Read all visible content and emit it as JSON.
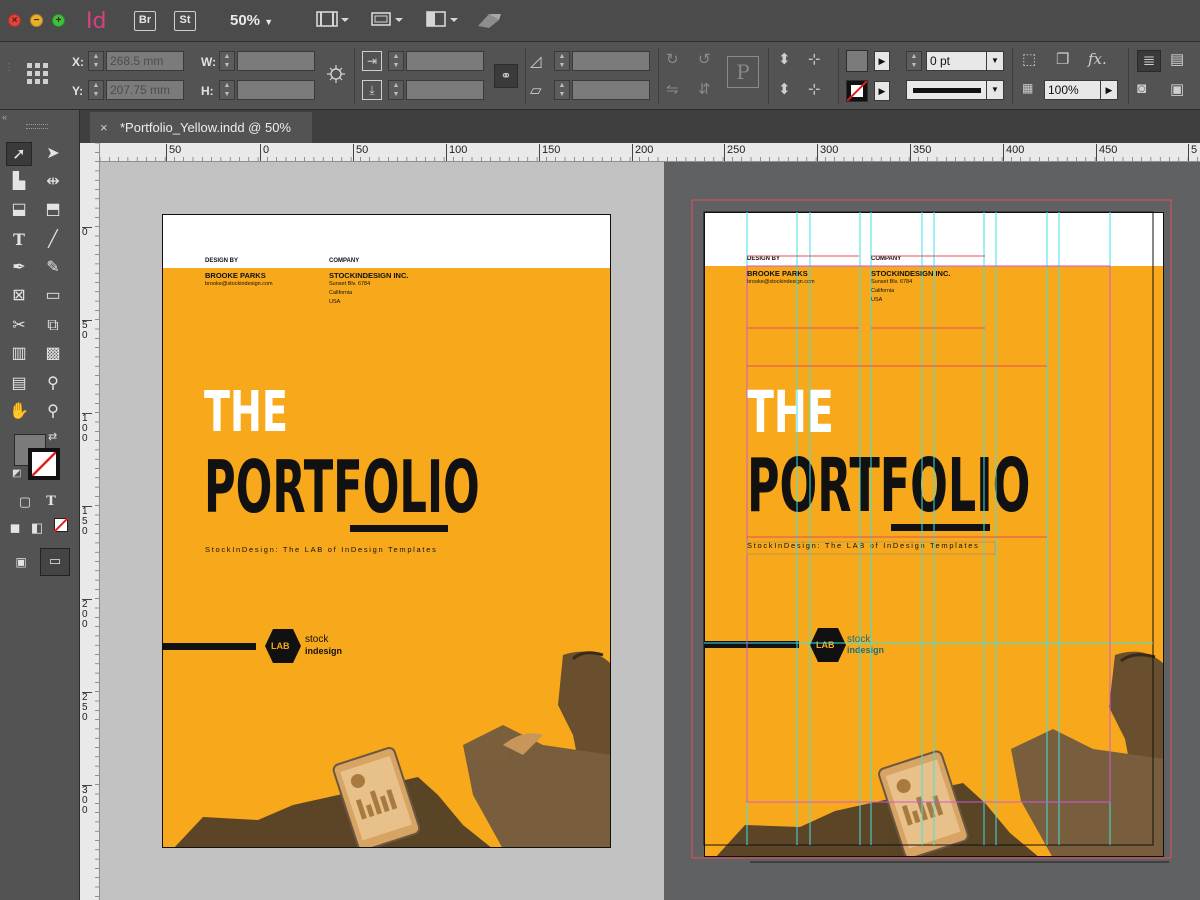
{
  "app": {
    "logo": "Id",
    "bridge_btn": "Br",
    "stock_btn": "St",
    "zoom": "50%",
    "zoom_caret": "▼"
  },
  "control": {
    "x_label": "X:",
    "y_label": "Y:",
    "w_label": "W:",
    "h_label": "H:",
    "x_value": "268.5 mm",
    "y_value": "207.75 mm",
    "stroke_weight": "0 pt",
    "scale": "100%",
    "fx_label": "fx."
  },
  "tab": {
    "close": "×",
    "title": "*Portfolio_Yellow.indd @ 50%"
  },
  "ruler": {
    "h_labels": [
      "50",
      "0",
      "50",
      "100",
      "150",
      "200",
      "250",
      "300",
      "350",
      "400",
      "450",
      "5"
    ],
    "v_labels": [
      "0",
      "50",
      "100",
      "150",
      "200",
      "250",
      "300"
    ]
  },
  "document": {
    "design_by_label": "DESIGN BY",
    "designer_name": "BROOKE PARKS",
    "designer_email": "brooke@stockindesign.com",
    "company_label": "COMPANY",
    "company_name": "STOCKINDESIGN INC.",
    "address_line1": "Sunset Blv. 6784",
    "address_line2": "California",
    "address_line3": "USA",
    "title_line1": "THE",
    "title_line2": "PORTFOLIO",
    "tagline": "StockInDesign: The LAB of InDesign Templates",
    "logo_badge": "LAB",
    "logo_word1": "stock",
    "logo_word2": "indesign"
  },
  "colors": {
    "page_yellow": "#f7a81b",
    "guide_cyan": "#3fe0e0",
    "margin_magenta": "#c85ad8",
    "bleed_red": "#e0505a"
  },
  "icons": [
    "selection-tool-icon",
    "direct-selection-tool-icon",
    "page-tool-icon",
    "gap-tool-icon",
    "content-collector-icon",
    "content-placer-icon",
    "type-tool-icon",
    "line-tool-icon",
    "pen-tool-icon",
    "pencil-tool-icon",
    "rectangle-frame-tool-icon",
    "rectangle-tool-icon",
    "scissors-tool-icon",
    "free-transform-tool-icon",
    "gradient-swatch-tool-icon",
    "gradient-feather-tool-icon",
    "note-tool-icon",
    "eyedropper-tool-icon",
    "hand-tool-icon",
    "zoom-tool-icon"
  ]
}
